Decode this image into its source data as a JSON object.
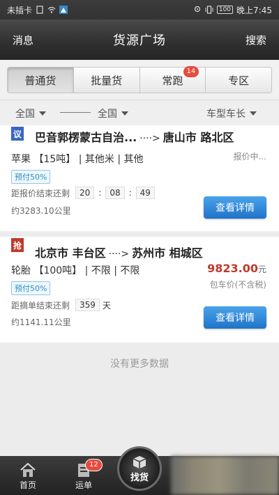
{
  "statusbar": {
    "carrier": "未插卡",
    "battery": "100",
    "time": "晚上7:45"
  },
  "header": {
    "title": "货源广场",
    "left": "消息",
    "right": "搜索"
  },
  "tabs": [
    {
      "label": "普通货"
    },
    {
      "label": "批量货"
    },
    {
      "label": "常跑",
      "badge": "14"
    },
    {
      "label": "专区"
    }
  ],
  "filters": {
    "from": "全国",
    "to": "全国",
    "truck": "车型车长"
  },
  "cards": [
    {
      "tag": "议",
      "from": "巴音郭楞蒙古自治...",
      "arrow": "····>",
      "to": "唐山市 路北区",
      "goods_name": "苹果",
      "goods_weight": "【15吨】",
      "goods_spec": "| 其他米 | 其他",
      "prepay": "预付50%",
      "status": "报价中...",
      "countdown_label": "距报价结束还剩",
      "countdown": [
        "20",
        "08",
        "49"
      ],
      "distance": "约3283.10公里",
      "button": "查看详情"
    },
    {
      "tag": "抢",
      "from": "北京市 丰台区",
      "arrow": "····>",
      "to": "苏州市 相城区",
      "goods_name": "轮胎",
      "goods_weight": "【100吨】",
      "goods_spec": "| 不限 | 不限",
      "prepay": "预付50%",
      "price": "9823.00",
      "price_unit": "元",
      "price_note": "包车价(不含税)",
      "countdown_label": "距摘单结束还剩",
      "days": "359",
      "days_unit": "天",
      "distance": "约1141.11公里",
      "button": "查看详情"
    }
  ],
  "no_more": "没有更多数据",
  "bottomnav": {
    "home": "首页",
    "orders": "运单",
    "orders_badge": "12",
    "find": "找货"
  }
}
